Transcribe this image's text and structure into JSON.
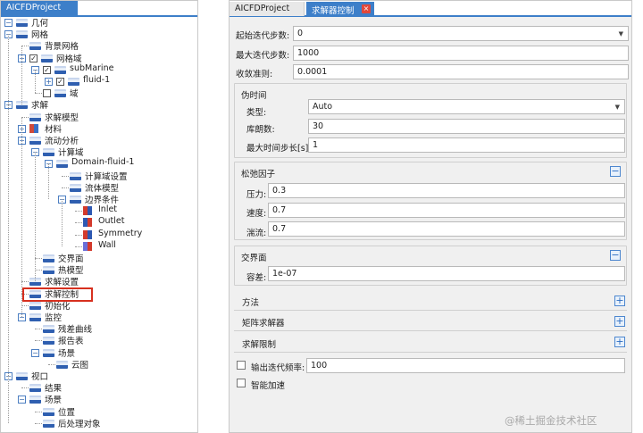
{
  "left_panel": {
    "tab_label": "AICFDProject",
    "tree": [
      {
        "label": "几何",
        "expander": "-",
        "depth": 0
      },
      {
        "label": "网格",
        "expander": "-",
        "depth": 0
      },
      {
        "label": "背景网格",
        "depth": 1
      },
      {
        "label": "网格域",
        "expander": "-",
        "checkbox": "checked",
        "depth": 1
      },
      {
        "label": "subMarine",
        "expander": "-",
        "checkbox": "checked",
        "depth": 2
      },
      {
        "label": "fluid-1",
        "expander": "+",
        "checkbox": "checked",
        "depth": 3
      },
      {
        "label": "域",
        "checkbox": "unchecked",
        "depth": 2
      },
      {
        "label": "求解",
        "expander": "-",
        "depth": 0
      },
      {
        "label": "求解模型",
        "depth": 1
      },
      {
        "label": "材料",
        "expander": "+",
        "icon": "material",
        "depth": 1
      },
      {
        "label": "流动分析",
        "expander": "-",
        "depth": 1
      },
      {
        "label": "计算域",
        "expander": "-",
        "depth": 2
      },
      {
        "label": "Domain-fluid-1",
        "expander": "-",
        "depth": 3
      },
      {
        "label": "计算域设置",
        "depth": 4
      },
      {
        "label": "流体模型",
        "depth": 4
      },
      {
        "label": "边界条件",
        "expander": "-",
        "depth": 4
      },
      {
        "label": "Inlet",
        "icon": "inlet",
        "depth": 5
      },
      {
        "label": "Outlet",
        "icon": "outlet",
        "depth": 5
      },
      {
        "label": "Symmetry",
        "icon": "symmetry",
        "depth": 5
      },
      {
        "label": "Wall",
        "icon": "wall",
        "depth": 5
      },
      {
        "label": "交界面",
        "depth": 2
      },
      {
        "label": "热模型",
        "depth": 2
      },
      {
        "label": "求解设置",
        "depth": 1
      },
      {
        "label": "求解控制",
        "depth": 1,
        "selected": true
      },
      {
        "label": "初始化",
        "depth": 1
      },
      {
        "label": "监控",
        "expander": "-",
        "depth": 1
      },
      {
        "label": "残差曲线",
        "depth": 2
      },
      {
        "label": "报告表",
        "depth": 2
      },
      {
        "label": "场景",
        "expander": "-",
        "depth": 2
      },
      {
        "label": "云图",
        "depth": 3
      },
      {
        "label": "视口",
        "expander": "-",
        "depth": 0
      },
      {
        "label": "结果",
        "depth": 1
      },
      {
        "label": "场景",
        "expander": "-",
        "depth": 1
      },
      {
        "label": "位置",
        "depth": 2
      },
      {
        "label": "后处理对象",
        "depth": 2
      }
    ]
  },
  "right_panel": {
    "tabs": [
      {
        "label": "AICFDProject",
        "active": false
      },
      {
        "label": "求解器控制",
        "active": true,
        "close_icon": "×"
      }
    ],
    "start_iter": {
      "label": "起始迭代步数:",
      "value": "0"
    },
    "max_iter": {
      "label": "最大迭代步数:",
      "value": "1000"
    },
    "convergence": {
      "label": "收敛准则:",
      "value": "0.0001"
    },
    "pseudo_time": {
      "title": "伪时间",
      "type": {
        "label": "类型:",
        "value": "Auto"
      },
      "courant": {
        "label": "库朗数:",
        "value": "30"
      },
      "max_step": {
        "label": "最大时间步长[s]:",
        "value": "1"
      }
    },
    "relaxation": {
      "title": "松弛因子",
      "pressure": {
        "label": "压力:",
        "value": "0.3"
      },
      "velocity": {
        "label": "速度:",
        "value": "0.7"
      },
      "turbulence": {
        "label": "湍流:",
        "value": "0.7"
      }
    },
    "interface": {
      "title": "交界面",
      "tolerance": {
        "label": "容差:",
        "value": "1e-07"
      }
    },
    "collapsed_sections": {
      "method": "方法",
      "matrix_solver": "矩阵求解器",
      "solve_limits": "求解限制"
    },
    "output_freq": {
      "label": "输出迭代频率:",
      "value": "100"
    },
    "smart_accel": {
      "label": "智能加速"
    },
    "toggle_symbols": {
      "collapse": "−",
      "expand": "+"
    }
  },
  "watermark": "@稀土掘金技术社区",
  "colors": {
    "accent": "#3d7fc9",
    "highlight": "#d7301f",
    "close": "#e2483b"
  }
}
